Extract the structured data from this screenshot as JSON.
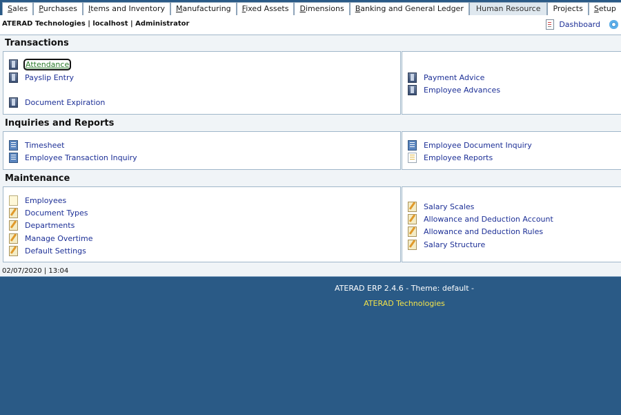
{
  "tabs": [
    {
      "label": "Sales",
      "key": "S",
      "rest": "ales"
    },
    {
      "label": "Purchases",
      "key": "P",
      "rest": "urchases"
    },
    {
      "label": "Items and Inventory",
      "key": "I",
      "rest": "tems and Inventory"
    },
    {
      "label": "Manufacturing",
      "key": "M",
      "rest": "anufacturing"
    },
    {
      "label": "Fixed Assets",
      "key": "F",
      "rest": "ixed Assets"
    },
    {
      "label": "Dimensions",
      "key": "D",
      "rest": "imensions"
    },
    {
      "label": "Banking and General Ledger",
      "key": "B",
      "rest": "anking and General Ledger"
    },
    {
      "label": "Human Resource",
      "key": "",
      "rest": "Human Resource"
    },
    {
      "label": "Projects",
      "key": "",
      "rest": "Projects"
    },
    {
      "label": "Setup",
      "key": "S",
      "rest": "etup"
    }
  ],
  "active_tab": "Human Resource",
  "header": {
    "info": "ATERAD Technologies | localhost | Administrator",
    "dashboard": "Dashboard"
  },
  "sections": {
    "transactions": {
      "title": "Transactions",
      "left": [
        "Attendance",
        "Payslip Entry",
        "Document Expiration"
      ],
      "right": [
        "Payment Advice",
        "Employee Advances"
      ]
    },
    "inquiries": {
      "title": "Inquiries and Reports",
      "left": [
        "Timesheet",
        "Employee Transaction Inquiry"
      ],
      "right": [
        "Employee Document Inquiry",
        "Employee Reports"
      ]
    },
    "maintenance": {
      "title": "Maintenance",
      "left": [
        "Employees",
        "Document Types",
        "Departments",
        "Manage Overtime",
        "Default Settings"
      ],
      "right": [
        "Salary Scales",
        "Allowance and Deduction Account",
        "Allowance and Deduction Rules",
        "Salary Structure"
      ]
    }
  },
  "datetime": "02/07/2020 | 13:04",
  "footer": {
    "version": "ATERAD ERP 2.4.6 - Theme: default -",
    "company": "ATERAD Technologies"
  }
}
